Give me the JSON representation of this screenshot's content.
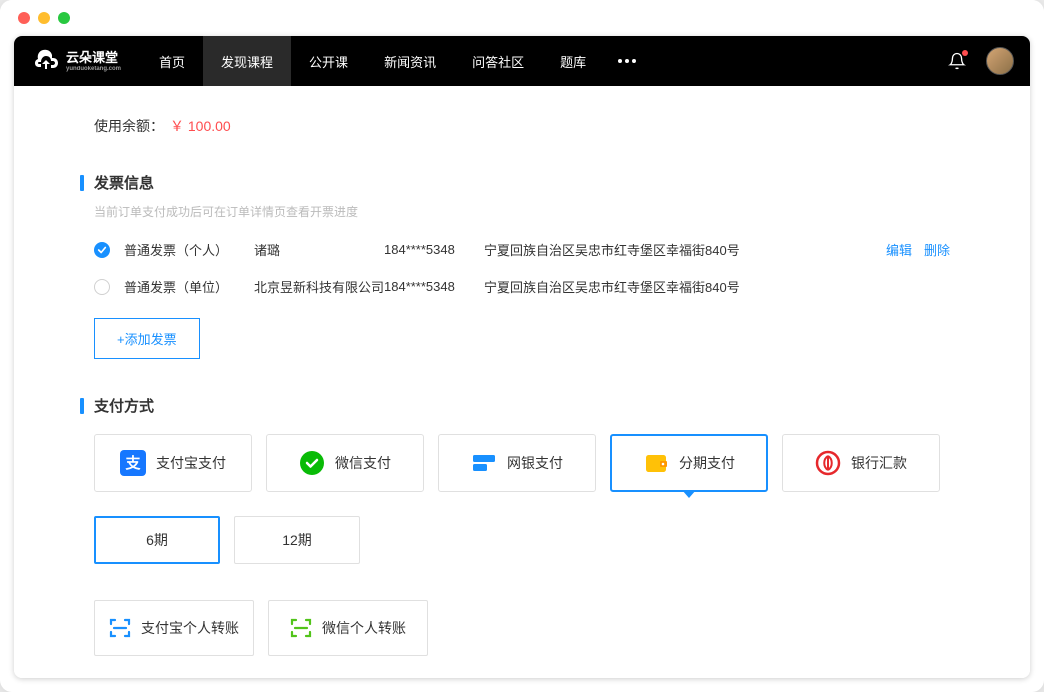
{
  "nav": {
    "items": [
      "首页",
      "发现课程",
      "公开课",
      "新闻资讯",
      "问答社区",
      "题库"
    ],
    "active_index": 1
  },
  "balance": {
    "label": "使用余额：",
    "value": "￥ 100.00"
  },
  "invoice_section": {
    "title": "发票信息",
    "hint": "当前订单支付成功后可在订单详情页查看开票进度",
    "rows": [
      {
        "type": "普通发票（个人）",
        "name": "诸璐",
        "phone": "184****5348",
        "address": "宁夏回族自治区吴忠市红寺堡区幸福街840号",
        "selected": true,
        "edit": "编辑",
        "delete": "删除"
      },
      {
        "type": "普通发票（单位）",
        "name": "北京昱新科技有限公司",
        "phone": "184****5348",
        "address": "宁夏回族自治区吴忠市红寺堡区幸福街840号",
        "selected": false
      }
    ],
    "add_button": "+添加发票"
  },
  "payment_section": {
    "title": "支付方式",
    "methods": [
      {
        "id": "alipay",
        "label": "支付宝支付"
      },
      {
        "id": "wechat",
        "label": "微信支付"
      },
      {
        "id": "unionpay",
        "label": "网银支付"
      },
      {
        "id": "installment",
        "label": "分期支付"
      },
      {
        "id": "bank",
        "label": "银行汇款"
      }
    ],
    "selected_method": "installment",
    "installments": [
      {
        "label": "6期",
        "selected": true
      },
      {
        "label": "12期",
        "selected": false
      }
    ],
    "transfers": [
      {
        "id": "alipay-transfer",
        "label": "支付宝个人转账",
        "color": "#1890ff"
      },
      {
        "id": "wechat-transfer",
        "label": "微信个人转账",
        "color": "#52c41a"
      }
    ]
  }
}
